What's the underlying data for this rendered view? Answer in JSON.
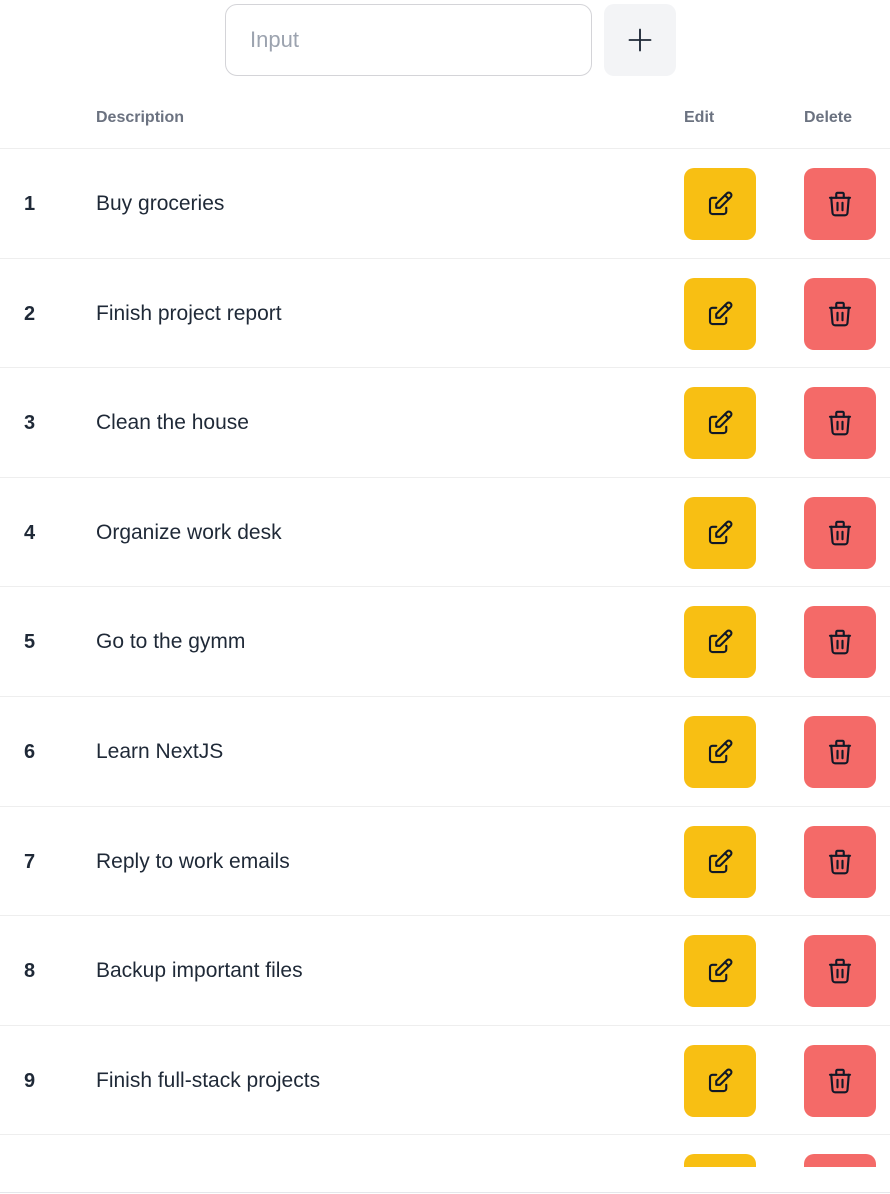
{
  "form": {
    "input_value": "",
    "input_placeholder": "Input",
    "add_button_icon": "plus-icon"
  },
  "table": {
    "headers": {
      "number": "",
      "description": "Description",
      "edit": "Edit",
      "delete": "Delete"
    },
    "rows": [
      {
        "number": "1",
        "description": "Buy groceries"
      },
      {
        "number": "2",
        "description": "Finish project report"
      },
      {
        "number": "3",
        "description": "Clean the house"
      },
      {
        "number": "4",
        "description": "Organize work desk"
      },
      {
        "number": "5",
        "description": "Go to the gymm"
      },
      {
        "number": "6",
        "description": "Learn NextJS"
      },
      {
        "number": "7",
        "description": "Reply to work emails"
      },
      {
        "number": "8",
        "description": "Backup important files"
      },
      {
        "number": "9",
        "description": "Finish full-stack projects"
      },
      {
        "number": "",
        "description": ""
      }
    ]
  },
  "icons": {
    "edit": "pencil-square-icon",
    "delete": "trash-icon"
  },
  "colors": {
    "edit_button": "#f8bf13",
    "delete_button": "#f46a68",
    "add_button": "#f3f4f6",
    "header_text": "#6b7280"
  }
}
